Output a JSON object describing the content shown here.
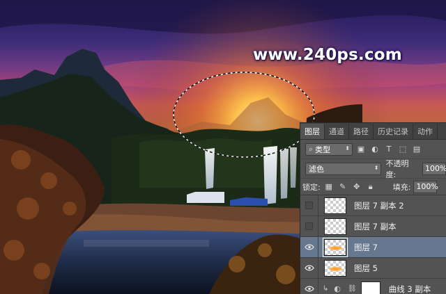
{
  "watermark": "www.240ps.com",
  "panel": {
    "tabs": [
      "图层",
      "通道",
      "路径",
      "历史记录",
      "动作"
    ],
    "active_tab": "图层",
    "filter": {
      "kind_label": "类型"
    },
    "blend_mode": "滤色",
    "opacity": {
      "label": "不透明度:",
      "value": "100%"
    },
    "lock": {
      "label": "锁定:"
    },
    "fill": {
      "label": "填充:",
      "value": "100%"
    },
    "layers": [
      {
        "name": "图层 7 副本 2",
        "visible": false,
        "selected": false,
        "thumb": "transparent"
      },
      {
        "name": "图层 7 副本",
        "visible": false,
        "selected": false,
        "thumb": "transparent"
      },
      {
        "name": "图层 7",
        "visible": true,
        "selected": true,
        "thumb": "orange-glow"
      },
      {
        "name": "图层 5",
        "visible": true,
        "selected": false,
        "thumb": "orange-glow"
      },
      {
        "name": "曲线 3 副本",
        "visible": true,
        "selected": false,
        "thumb": "adjustment"
      }
    ]
  },
  "colors": {
    "panel_bg": "#535353",
    "selected_row": "#66788f",
    "glow": "#ffb347"
  }
}
